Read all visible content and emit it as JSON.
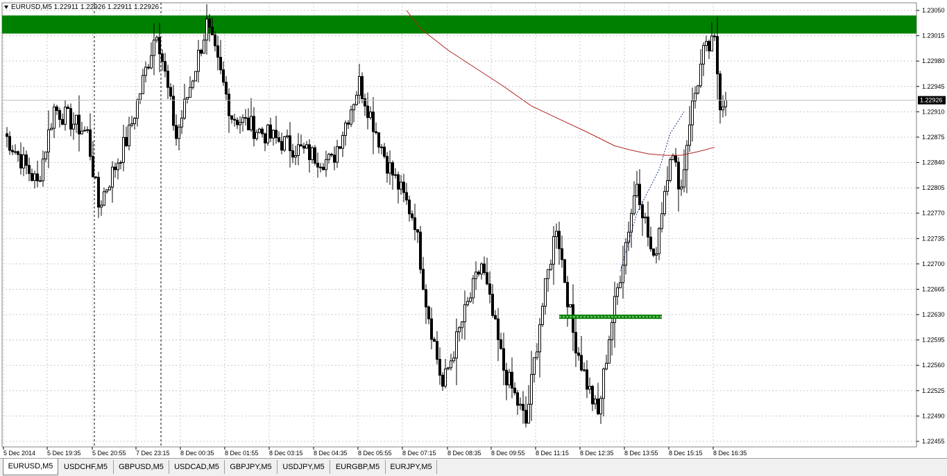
{
  "window": {
    "symbol_line": "EURUSD,M5  1.22911 1.22926 1.22911 1.22926"
  },
  "tabs": [
    {
      "label": "EURUSD,M5",
      "active": true
    },
    {
      "label": "USDCHF,M5",
      "active": false
    },
    {
      "label": "GBPUSD,M5",
      "active": false
    },
    {
      "label": "USDCAD,M5",
      "active": false
    },
    {
      "label": "GBPJPY,M5",
      "active": false
    },
    {
      "label": "USDJPY,M5",
      "active": false
    },
    {
      "label": "EURGBP,M5",
      "active": false
    },
    {
      "label": "EURJPY,M5",
      "active": false
    }
  ],
  "colors": {
    "candle": "#000000",
    "grid": "#c8c8c8",
    "zone": "#008000",
    "moving_average": "#b22222",
    "price_box_bg": "#000000",
    "price_box_text": "#ffffff"
  },
  "chart_data": {
    "type": "candlestick",
    "symbol": "EURUSD",
    "timeframe": "M5",
    "ohlc_current": {
      "open": 1.22911,
      "high": 1.22926,
      "low": 1.22911,
      "close": 1.22926
    },
    "current_price": "1.22926",
    "ylim": [
      1.22455,
      1.2305
    ],
    "y_ticks": [
      "1.23050",
      "1.23015",
      "1.22980",
      "1.22945",
      "1.22910",
      "1.22875",
      "1.22840",
      "1.22805",
      "1.22770",
      "1.22735",
      "1.22700",
      "1.22665",
      "1.22630",
      "1.22595",
      "1.22560",
      "1.22525",
      "1.22490",
      "1.22455"
    ],
    "x_ticks": [
      "5 Dec 2014",
      "5 Dec 19:35",
      "5 Dec 20:55",
      "7 Dec 23:15",
      "8 Dec 00:35",
      "8 Dec 01:55",
      "8 Dec 03:15",
      "8 Dec 04:35",
      "8 Dec 05:55",
      "8 Dec 07:15",
      "8 Dec 08:35",
      "8 Dec 09:55",
      "8 Dec 11:15",
      "8 Dec 12:35",
      "8 Dec 13:55",
      "8 Dec 15:15",
      "8 Dec 16:35"
    ],
    "period_separators": [
      "5 Dec 20:55",
      "7 Dec 23:15"
    ],
    "zones": [
      {
        "type": "rectangle",
        "y_from": 1.23018,
        "y_to": 1.23043,
        "x_from_bar": 0,
        "x_to_bar": 335
      },
      {
        "type": "hline-band",
        "y": 1.22627,
        "x_from_bar": 200,
        "x_to_bar": 237
      }
    ],
    "moving_average": {
      "points": [
        [
          145,
          1.2305
        ],
        [
          150,
          1.23025
        ],
        [
          160,
          1.22995
        ],
        [
          170,
          1.2297
        ],
        [
          180,
          1.22945
        ],
        [
          190,
          1.22918
        ],
        [
          200,
          1.229
        ],
        [
          210,
          1.22882
        ],
        [
          220,
          1.22863
        ],
        [
          226,
          1.22857
        ],
        [
          232,
          1.22852
        ],
        [
          238,
          1.2285
        ],
        [
          244,
          1.2285
        ],
        [
          250,
          1.22855
        ],
        [
          256,
          1.22861
        ]
      ]
    },
    "dashed_trend": {
      "points": [
        [
          222,
          1.2269
        ],
        [
          228,
          1.2277
        ],
        [
          236,
          1.2283
        ],
        [
          240,
          1.2288
        ],
        [
          245,
          1.2291
        ]
      ]
    },
    "key_points": [
      [
        0,
        1.2288
      ],
      [
        12,
        1.2281
      ],
      [
        18,
        1.22915
      ],
      [
        30,
        1.2288
      ],
      [
        34,
        1.2278
      ],
      [
        45,
        1.2288
      ],
      [
        55,
        1.23025
      ],
      [
        62,
        1.22875
      ],
      [
        73,
        1.2303
      ],
      [
        82,
        1.22905
      ],
      [
        96,
        1.22875
      ],
      [
        108,
        1.22855
      ],
      [
        118,
        1.2284
      ],
      [
        128,
        1.2295
      ],
      [
        138,
        1.2284
      ],
      [
        148,
        1.2276
      ],
      [
        152,
        1.2265
      ],
      [
        158,
        1.2253
      ],
      [
        165,
        1.2262
      ],
      [
        172,
        1.227
      ],
      [
        180,
        1.22555
      ],
      [
        188,
        1.2248
      ],
      [
        193,
        1.2262
      ],
      [
        199,
        1.22755
      ],
      [
        205,
        1.22605
      ],
      [
        210,
        1.22535
      ],
      [
        214,
        1.2249
      ],
      [
        218,
        1.226
      ],
      [
        224,
        1.2273
      ],
      [
        228,
        1.22815
      ],
      [
        234,
        1.227
      ],
      [
        240,
        1.22855
      ],
      [
        244,
        1.22805
      ],
      [
        247,
        1.229
      ],
      [
        252,
        1.2299
      ],
      [
        256,
        1.23005
      ],
      [
        258,
        1.22925
      ],
      [
        260,
        1.22926
      ]
    ]
  }
}
